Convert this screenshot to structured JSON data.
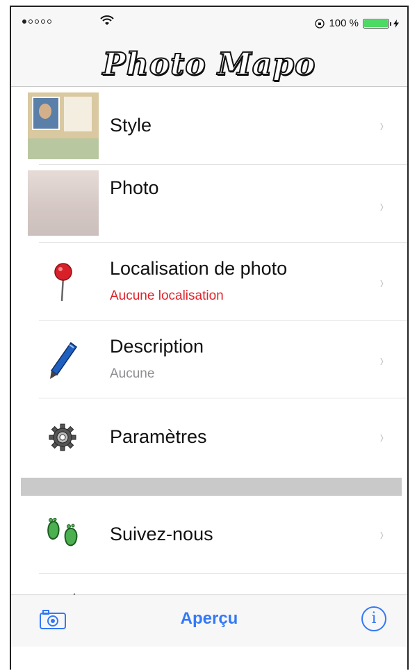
{
  "status_bar": {
    "battery": "100 %",
    "signal_bars_filled": 1,
    "signal_bars_total": 5
  },
  "header": {
    "logo": "Photo Mapo"
  },
  "rows": [
    {
      "title": "Style",
      "icon": "style-thumbnail"
    },
    {
      "title": "Photo",
      "icon": "photo-thumbnail"
    },
    {
      "title": "Localisation de photo",
      "subtitle": "Aucune localisation",
      "subtitle_color": "#e0242b",
      "icon": "map-pin-icon"
    },
    {
      "title": "Description",
      "subtitle": "Aucune",
      "subtitle_color": "#8e8e93",
      "icon": "pen-icon"
    },
    {
      "title": "Paramètres",
      "icon": "gear-icon"
    },
    {
      "title": "Suivez-nous",
      "icon": "footprints-icon"
    }
  ],
  "tab_bar": {
    "center_label": "Aperçu",
    "left_icon": "camera-icon",
    "right_icon": "info-icon",
    "info_glyph": "i",
    "accent": "#3478f6"
  },
  "chevron": "›"
}
